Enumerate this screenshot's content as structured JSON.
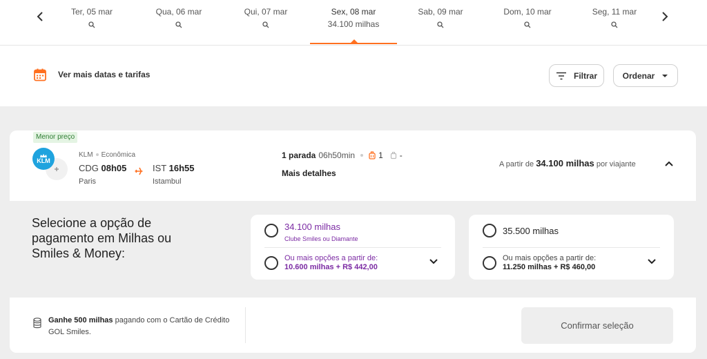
{
  "dates": {
    "tabs": [
      {
        "label": "Ter, 05 mar"
      },
      {
        "label": "Qua, 06 mar"
      },
      {
        "label": "Qui, 07 mar"
      },
      {
        "label": "Sex, 08 mar",
        "price": "34.100 milhas"
      },
      {
        "label": "Sab, 09 mar"
      },
      {
        "label": "Dom, 10 mar"
      },
      {
        "label": "Seg, 11 mar"
      }
    ],
    "active_index": 3
  },
  "toolbar": {
    "more_dates": "Ver mais datas e tarifas",
    "filter": "Filtrar",
    "sort": "Ordenar"
  },
  "flight": {
    "badge": "Menor preço",
    "logo_text": "KLM",
    "airline": "KLM",
    "cabin": "Econômica",
    "from_code": "CDG",
    "from_time": "08h05",
    "from_city": "Paris",
    "to_code": "IST",
    "to_time": "16h55",
    "to_city": "Istambul",
    "stops": "1 parada",
    "duration": "06h50min",
    "bags": "1",
    "carry": "-",
    "details": "Mais detalhes",
    "price_prefix": "A partir de",
    "price": "34.100 milhas",
    "price_suffix": "por viajante"
  },
  "payment": {
    "title": "Selecione a opção de pagamento em Milhas ou Smiles & Money:",
    "option_a": {
      "main": "34.100 milhas",
      "sub": "Clube Smiles ou Diamante",
      "more_label": "Ou mais opções a partir de:",
      "more_value": "10.600 milhas + R$ 442,00"
    },
    "option_b": {
      "main": "35.500 milhas",
      "more_label": "Ou mais opções a partir de:",
      "more_value": "11.250 milhas + R$ 460,00"
    }
  },
  "footer": {
    "gain_bold": "Ganhe 500 milhas",
    "gain_rest": "pagando com o Cartão de Crédito GOL Smiles.",
    "confirm": "Confirmar seleção"
  },
  "colors": {
    "accent": "#ff7020",
    "purple": "#7b2aa3",
    "klm": "#1fa3de"
  }
}
